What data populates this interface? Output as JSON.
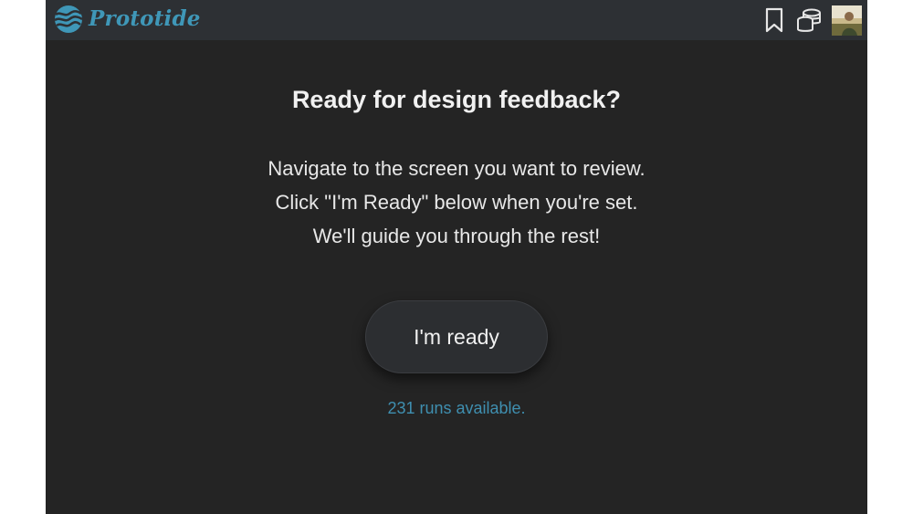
{
  "header": {
    "logo_text": "Prototide",
    "logo_icon": "wave-globe-icon",
    "actions": [
      {
        "icon": "bookmark-icon"
      },
      {
        "icon": "coins-stack-icon"
      },
      {
        "icon": "user-avatar"
      }
    ]
  },
  "main": {
    "heading": "Ready for design feedback?",
    "instructions": [
      "Navigate to the screen you want to review.",
      "Click \"I'm Ready\" below when you're set.",
      "We'll guide you through the rest!"
    ],
    "ready_button_label": "I'm ready",
    "runs_text": "231 runs available."
  },
  "colors": {
    "background": "#242424",
    "topbar": "#2d3034",
    "accent": "#3f97b8",
    "button": "#2c2e31",
    "text": "#ececec"
  }
}
